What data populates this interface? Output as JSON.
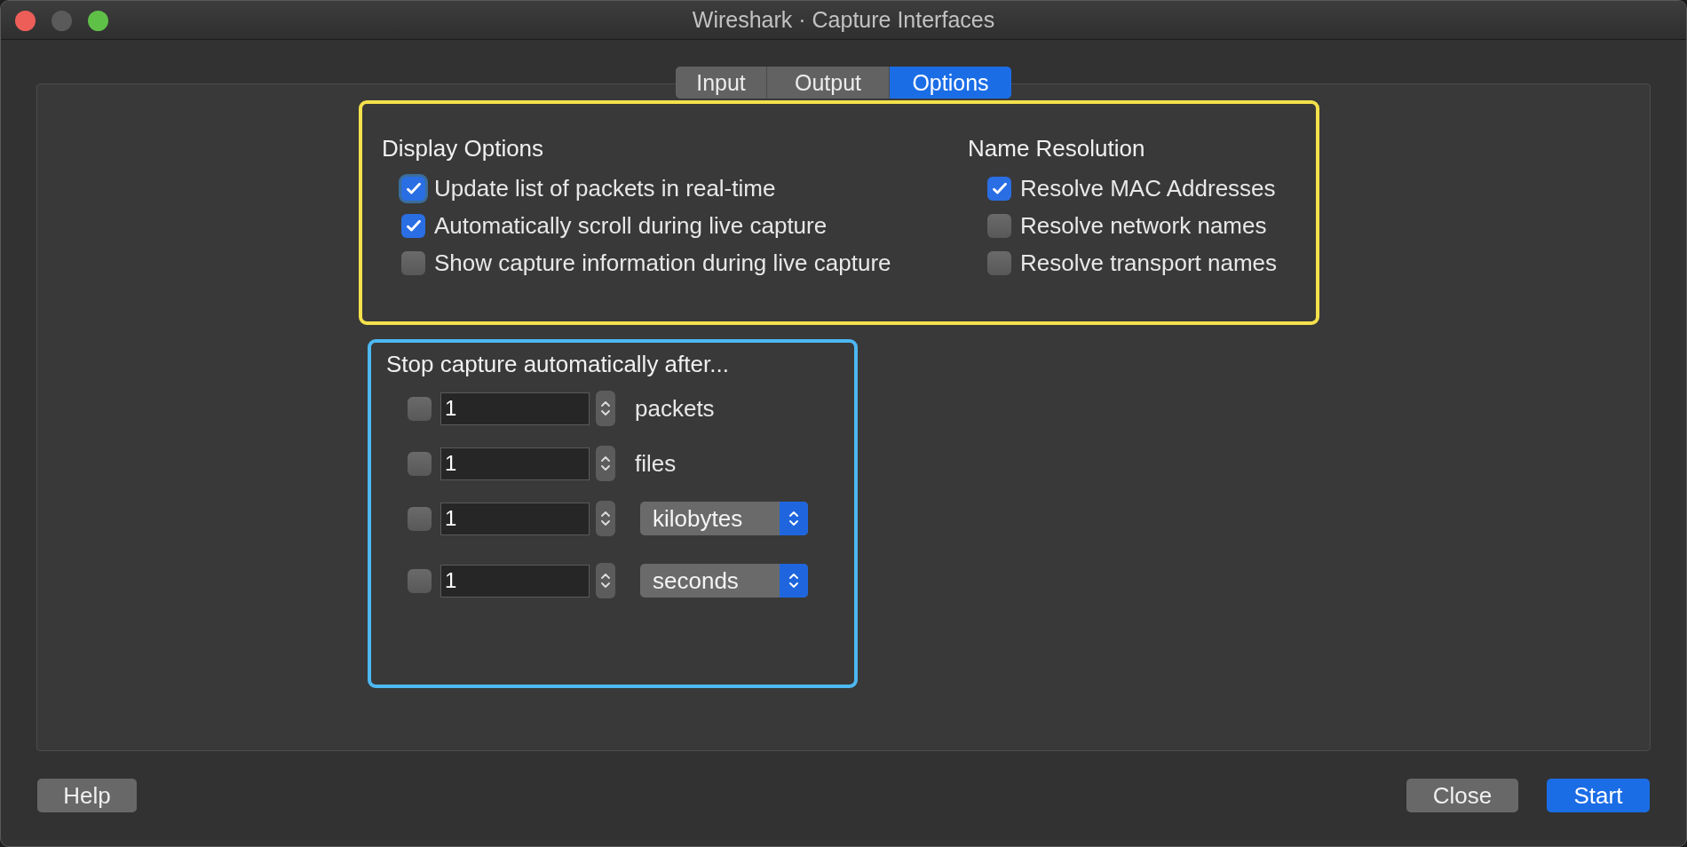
{
  "window": {
    "title": "Wireshark · Capture Interfaces"
  },
  "tabs": [
    {
      "label": "Input",
      "selected": false
    },
    {
      "label": "Output",
      "selected": false
    },
    {
      "label": "Options",
      "selected": true
    }
  ],
  "display_options": {
    "heading": "Display Options",
    "items": [
      {
        "label": "Update list of packets in real-time",
        "checked": true,
        "focused": true
      },
      {
        "label": "Automatically scroll during live capture",
        "checked": true
      },
      {
        "label": "Show capture information during live capture",
        "checked": false
      }
    ]
  },
  "name_resolution": {
    "heading": "Name Resolution",
    "items": [
      {
        "label": "Resolve MAC Addresses",
        "checked": true
      },
      {
        "label": "Resolve network names",
        "checked": false
      },
      {
        "label": "Resolve transport names",
        "checked": false
      }
    ]
  },
  "stop_capture": {
    "heading": "Stop capture automatically after...",
    "rows": [
      {
        "kind": "label",
        "checked": false,
        "value": "1",
        "unit": "packets"
      },
      {
        "kind": "label",
        "checked": false,
        "value": "1",
        "unit": "files"
      },
      {
        "kind": "dropdown",
        "checked": false,
        "value": "1",
        "unit": "kilobytes"
      },
      {
        "kind": "dropdown",
        "checked": false,
        "value": "1",
        "unit": "seconds"
      }
    ]
  },
  "footer": {
    "left_buttons": [
      {
        "label": "Help",
        "primary": false
      }
    ],
    "right_buttons": [
      {
        "label": "Close",
        "primary": false
      },
      {
        "label": "Start",
        "primary": true
      }
    ]
  }
}
